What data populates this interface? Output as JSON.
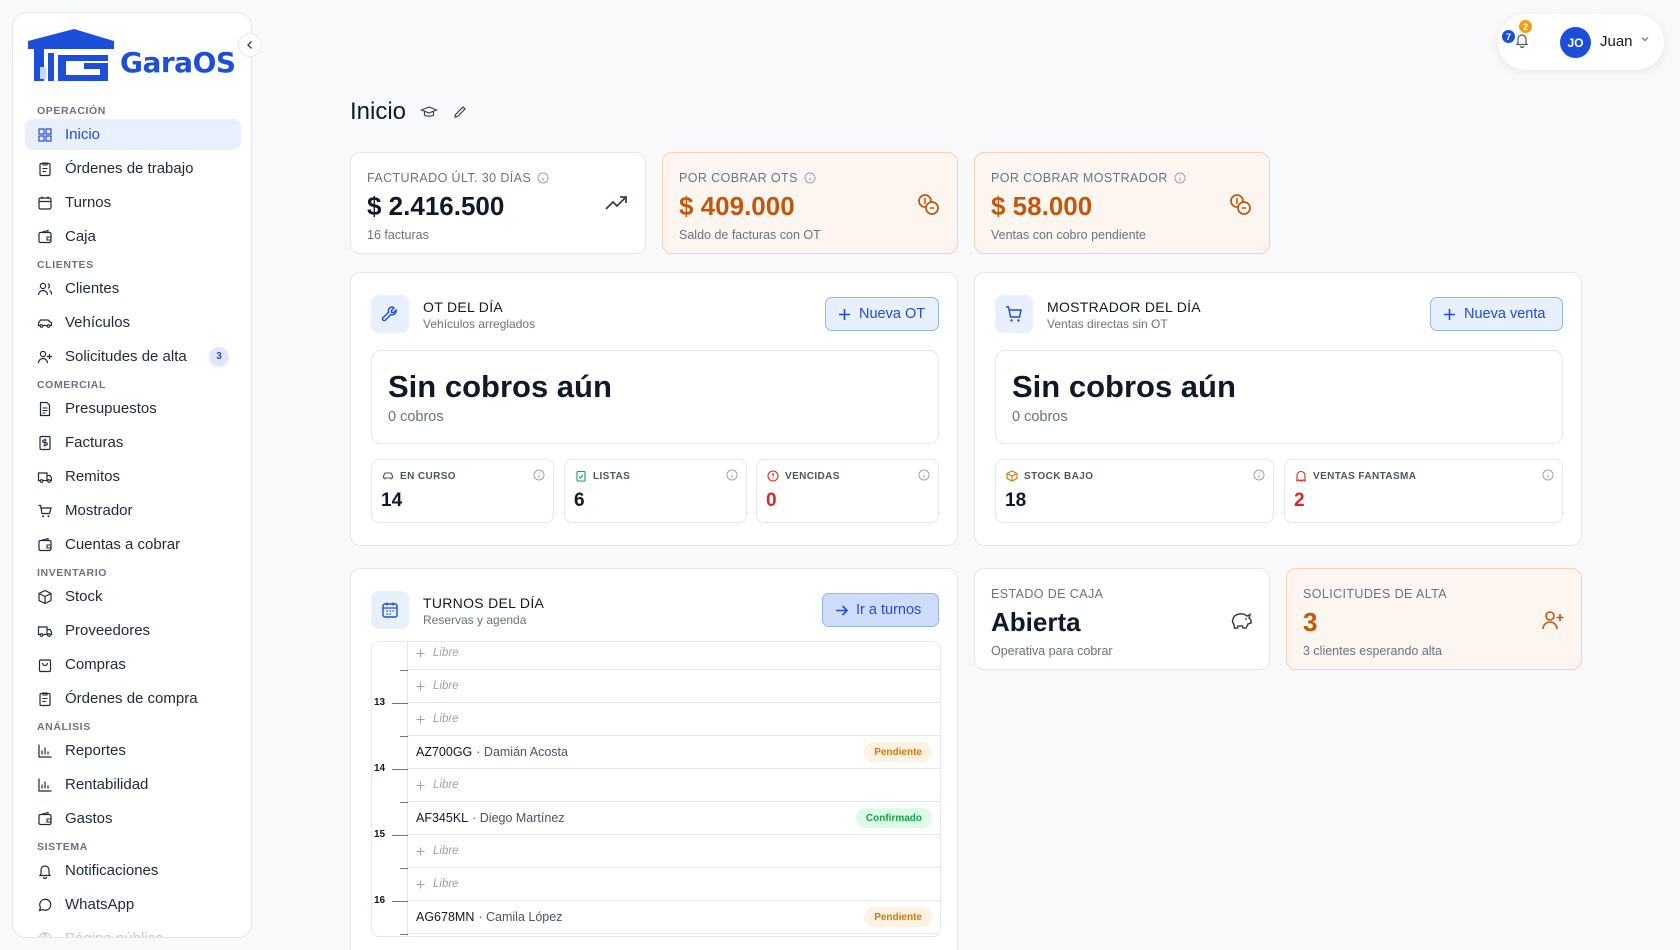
{
  "app": {
    "name": "GaraOS"
  },
  "sidebar": {
    "sections": [
      {
        "label": "OPERACIÓN",
        "items": [
          {
            "label": "Inicio",
            "icon": "grid-icon",
            "active": true
          },
          {
            "label": "Órdenes de trabajo",
            "icon": "clipboard-icon"
          },
          {
            "label": "Turnos",
            "icon": "calendar-icon"
          },
          {
            "label": "Caja",
            "icon": "wallet-icon"
          }
        ]
      },
      {
        "label": "CLIENTES",
        "items": [
          {
            "label": "Clientes",
            "icon": "users-icon"
          },
          {
            "label": "Vehículos",
            "icon": "car-icon"
          },
          {
            "label": "Solicitudes de alta",
            "icon": "user-plus-icon",
            "badge": "3"
          }
        ]
      },
      {
        "label": "COMERCIAL",
        "items": [
          {
            "label": "Presupuestos",
            "icon": "file-text-icon"
          },
          {
            "label": "Facturas",
            "icon": "dollar-file-icon"
          },
          {
            "label": "Remitos",
            "icon": "truck-icon"
          },
          {
            "label": "Mostrador",
            "icon": "cart-icon"
          },
          {
            "label": "Cuentas a cobrar",
            "icon": "wallet-icon"
          }
        ]
      },
      {
        "label": "INVENTARIO",
        "items": [
          {
            "label": "Stock",
            "icon": "box-icon"
          },
          {
            "label": "Proveedores",
            "icon": "truck-icon"
          },
          {
            "label": "Compras",
            "icon": "bag-icon"
          },
          {
            "label": "Órdenes de compra",
            "icon": "clipboard-icon"
          }
        ]
      },
      {
        "label": "ANÁLISIS",
        "items": [
          {
            "label": "Reportes",
            "icon": "bar-chart-icon"
          },
          {
            "label": "Rentabilidad",
            "icon": "bar-chart-icon"
          },
          {
            "label": "Gastos",
            "icon": "wallet-icon"
          }
        ]
      },
      {
        "label": "SISTEMA",
        "items": [
          {
            "label": "Notificaciones",
            "icon": "bell-icon"
          },
          {
            "label": "WhatsApp",
            "icon": "chat-icon"
          },
          {
            "label": "Página pública",
            "icon": "globe-icon"
          }
        ]
      }
    ]
  },
  "topbar": {
    "notif_badge_blue": "7",
    "notif_badge_orange": "2",
    "avatar_initials": "JO",
    "user_name": "Juan"
  },
  "page": {
    "title": "Inicio"
  },
  "kpis": {
    "facturado": {
      "label": "FACTURADO ÚLT. 30 DÍAS",
      "value": "$ 2.416.500",
      "sub": "16 facturas"
    },
    "cobrar_ots": {
      "label": "POR COBRAR OTS",
      "value": "$ 409.000",
      "sub": "Saldo de facturas con OT"
    },
    "cobrar_mostrador": {
      "label": "POR COBRAR MOSTRADOR",
      "value": "$ 58.000",
      "sub": "Ventas con cobro pendiente"
    }
  },
  "ot_dia": {
    "title": "OT DEL DÍA",
    "sub": "Vehículos arreglados",
    "button": "Nueva OT",
    "empty_title": "Sin cobros aún",
    "empty_sub": "0 cobros",
    "stats": [
      {
        "label": "EN CURSO",
        "value": "14"
      },
      {
        "label": "LISTAS",
        "value": "6"
      },
      {
        "label": "VENCIDAS",
        "value": "0"
      }
    ]
  },
  "mostrador_dia": {
    "title": "MOSTRADOR DEL DÍA",
    "sub": "Ventas directas sin OT",
    "button": "Nueva venta",
    "empty_title": "Sin cobros aún",
    "empty_sub": "0 cobros",
    "stats": [
      {
        "label": "STOCK BAJO",
        "value": "18"
      },
      {
        "label": "VENTAS FANTASMA",
        "value": "2"
      }
    ]
  },
  "turnos_dia": {
    "title": "TURNOS DEL DÍA",
    "sub": "Reservas y agenda",
    "button": "Ir a turnos",
    "hours": [
      "13",
      "14",
      "15",
      "16"
    ],
    "slots": [
      {
        "type": "free",
        "label": "Libre"
      },
      {
        "type": "free",
        "label": "Libre"
      },
      {
        "type": "free",
        "label": "Libre"
      },
      {
        "type": "booked",
        "plate": "AZ700GG",
        "name": "· Damián Acosta",
        "status": "Pendiente"
      },
      {
        "type": "free",
        "label": "Libre"
      },
      {
        "type": "booked",
        "plate": "AF345KL",
        "name": "· Diego Martínez",
        "status": "Confirmado"
      },
      {
        "type": "free",
        "label": "Libre"
      },
      {
        "type": "free",
        "label": "Libre"
      },
      {
        "type": "booked",
        "plate": "AG678MN",
        "name": "· Camila López",
        "status": "Pendiente"
      }
    ]
  },
  "estado_caja": {
    "label": "ESTADO DE CAJA",
    "value": "Abierta",
    "sub": "Operativa para cobrar"
  },
  "solicitudes": {
    "label": "SOLICITUDES DE ALTA",
    "value": "3",
    "sub": "3 clientes esperando alta"
  },
  "colors": {
    "accent": "#1d4ed8",
    "orange": "#c2570c",
    "red": "#dc2626",
    "warm_bg": "#fdf6f0"
  }
}
